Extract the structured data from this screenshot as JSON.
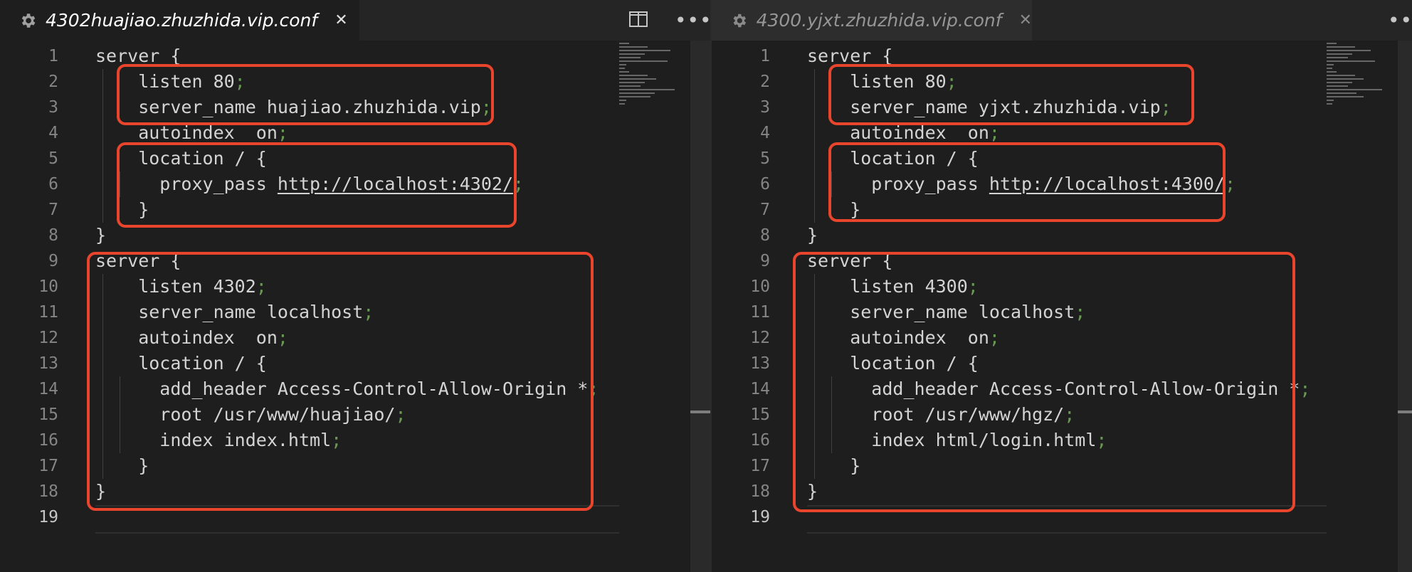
{
  "colors": {
    "editor_bg": "#1e1e1e",
    "tabbar_bg": "#252526",
    "text": "#d4d4d4",
    "punct": "#6a9955",
    "line_number": "#858585",
    "highlight_border": "#e8452c"
  },
  "left": {
    "tab": {
      "title": "4302huajiao.zhuzhida.vip.conf",
      "close_glyph": "✕",
      "gear_icon": "gear-icon"
    },
    "actions": {
      "split_icon": "split-editor-icon",
      "more_glyph": "•••"
    },
    "lines": [
      {
        "num": "1",
        "code": "server {",
        "semi": ""
      },
      {
        "num": "2",
        "code": "    listen 80",
        "semi": ";"
      },
      {
        "num": "3",
        "code": "    server_name huajiao.zhuzhida.vip",
        "semi": ";"
      },
      {
        "num": "4",
        "code": "    autoindex  on",
        "semi": ";"
      },
      {
        "num": "5",
        "code": "    location / {",
        "semi": ""
      },
      {
        "num": "6",
        "code": "      proxy_pass ",
        "url": "http://localhost:4302/",
        "semi": ";"
      },
      {
        "num": "7",
        "code": "    }",
        "semi": ""
      },
      {
        "num": "8",
        "code": "}",
        "semi": ""
      },
      {
        "num": "9",
        "code": "server {",
        "semi": ""
      },
      {
        "num": "10",
        "code": "    listen 4302",
        "semi": ";"
      },
      {
        "num": "11",
        "code": "    server_name localhost",
        "semi": ";"
      },
      {
        "num": "12",
        "code": "    autoindex  on",
        "semi": ";"
      },
      {
        "num": "13",
        "code": "    location / {",
        "semi": ""
      },
      {
        "num": "14",
        "code": "      add_header Access-Control-Allow-Origin *",
        "semi": ";"
      },
      {
        "num": "15",
        "code": "      root /usr/www/huajiao/",
        "semi": ";"
      },
      {
        "num": "16",
        "code": "      index index.html",
        "semi": ";"
      },
      {
        "num": "17",
        "code": "    }",
        "semi": ""
      },
      {
        "num": "18",
        "code": "}",
        "semi": ""
      },
      {
        "num": "19",
        "code": "",
        "semi": ""
      }
    ]
  },
  "right": {
    "tab": {
      "title": "4300.yjxt.zhuzhida.vip.conf",
      "close_glyph": "✕",
      "gear_icon": "gear-icon"
    },
    "actions": {
      "more_glyph": "•••"
    },
    "lines": [
      {
        "num": "1",
        "code": "server {",
        "semi": ""
      },
      {
        "num": "2",
        "code": "    listen 80",
        "semi": ";"
      },
      {
        "num": "3",
        "code": "    server_name yjxt.zhuzhida.vip",
        "semi": ";"
      },
      {
        "num": "4",
        "code": "    autoindex  on",
        "semi": ";"
      },
      {
        "num": "5",
        "code": "    location / {",
        "semi": ""
      },
      {
        "num": "6",
        "code": "      proxy_pass ",
        "url": "http://localhost:4300/",
        "semi": ";"
      },
      {
        "num": "7",
        "code": "    }",
        "semi": ""
      },
      {
        "num": "8",
        "code": "}",
        "semi": ""
      },
      {
        "num": "9",
        "code": "server {",
        "semi": ""
      },
      {
        "num": "10",
        "code": "    listen 4300",
        "semi": ";"
      },
      {
        "num": "11",
        "code": "    server_name localhost",
        "semi": ";"
      },
      {
        "num": "12",
        "code": "    autoindex  on",
        "semi": ";"
      },
      {
        "num": "13",
        "code": "    location / {",
        "semi": ""
      },
      {
        "num": "14",
        "code": "      add_header Access-Control-Allow-Origin *",
        "semi": ";"
      },
      {
        "num": "15",
        "code": "      root /usr/www/hgz/",
        "semi": ";"
      },
      {
        "num": "16",
        "code": "      index html/login.html",
        "semi": ";"
      },
      {
        "num": "17",
        "code": "    }",
        "semi": ""
      },
      {
        "num": "18",
        "code": "}",
        "semi": ""
      },
      {
        "num": "19",
        "code": "",
        "semi": ""
      }
    ]
  }
}
